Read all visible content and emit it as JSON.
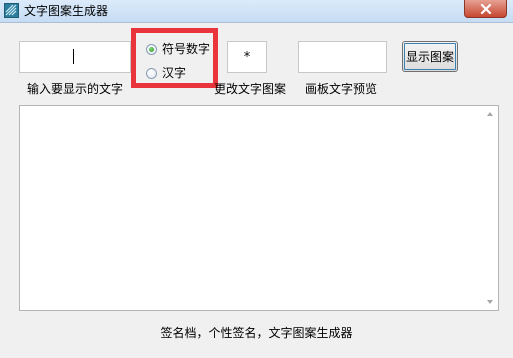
{
  "window": {
    "title": "文字图案生成器",
    "icon": "app-icon"
  },
  "input": {
    "text_value": ""
  },
  "mode": {
    "options": [
      {
        "label": "符号数字",
        "checked": true
      },
      {
        "label": "汉字",
        "checked": false
      }
    ]
  },
  "symbol_input": {
    "value": "*"
  },
  "preview_input": {
    "value": ""
  },
  "buttons": {
    "show": "显示图案"
  },
  "captions": {
    "input": "输入要显示的文字",
    "change": "更改文字图案",
    "preview": "画板文字预览"
  },
  "output": {
    "value": ""
  },
  "footer": {
    "text": "签名档，个性签名，文字图案生成器"
  },
  "colors": {
    "highlight_border": "#e8343a",
    "titlebar": "#c5dcf4"
  }
}
